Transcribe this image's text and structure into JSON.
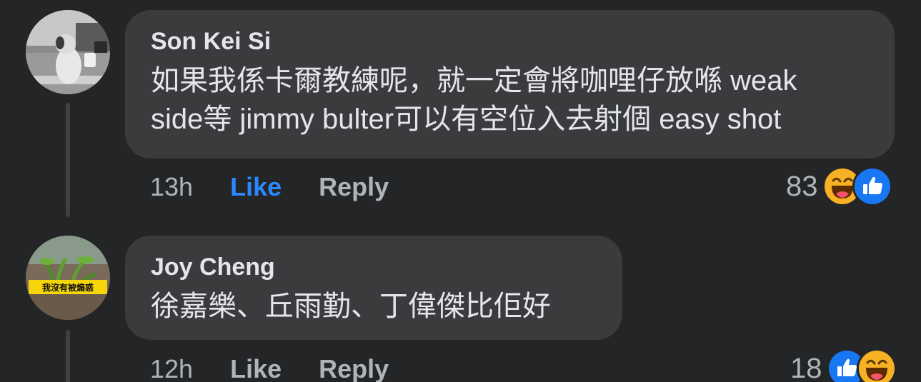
{
  "comments": [
    {
      "author": "Son Kei Si",
      "text": "如果我係卡爾教練呢，就一定會將咖哩仔放喺 weak\nside等 jimmy bulter可以有空位入去射個 easy shot",
      "time": "13h",
      "like_label": "Like",
      "like_active": true,
      "reply_label": "Reply",
      "reaction_count": "83",
      "reactions": [
        "haha-icon",
        "like-icon"
      ]
    },
    {
      "author": "Joy Cheng",
      "text": "徐嘉樂、丘雨勤、丁偉傑比佢好",
      "time": "12h",
      "like_label": "Like",
      "like_active": false,
      "reply_label": "Reply",
      "reaction_count": "18",
      "reactions": [
        "like-icon",
        "haha-icon"
      ],
      "avatar_badge": "我沒有被煽惑"
    }
  ],
  "colors": {
    "background": "#242526",
    "bubble": "#3a3b3c",
    "like_active": "#2d88ff",
    "text_primary": "#e4e6eb",
    "text_secondary": "#b0b3b8",
    "haha": "#f7b125",
    "like_reaction": "#1877f2"
  }
}
